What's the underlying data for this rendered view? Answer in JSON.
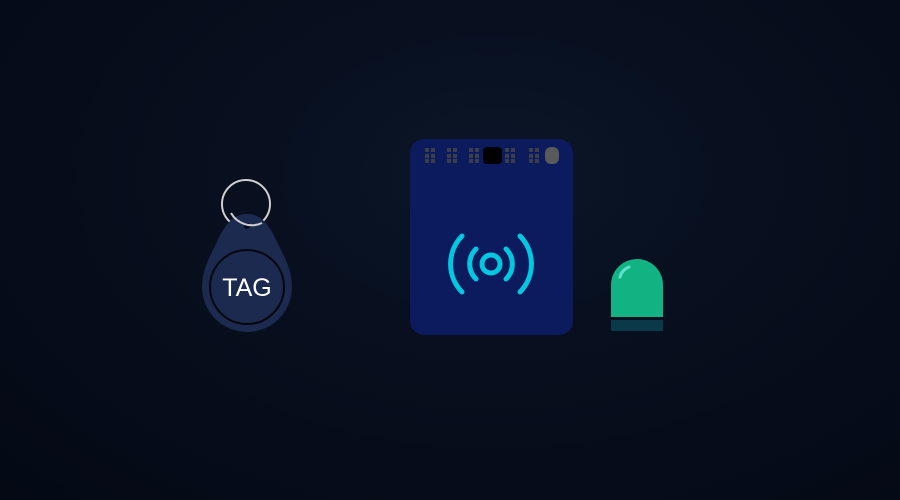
{
  "key_fob": {
    "label": "TAG"
  },
  "colors": {
    "background": "#060d1c",
    "fob": "#1b2a4e",
    "reader": "#0c1a5e",
    "signal": "#00c8e0",
    "led_on": "#12b383",
    "led_base": "#0a3a4a"
  }
}
